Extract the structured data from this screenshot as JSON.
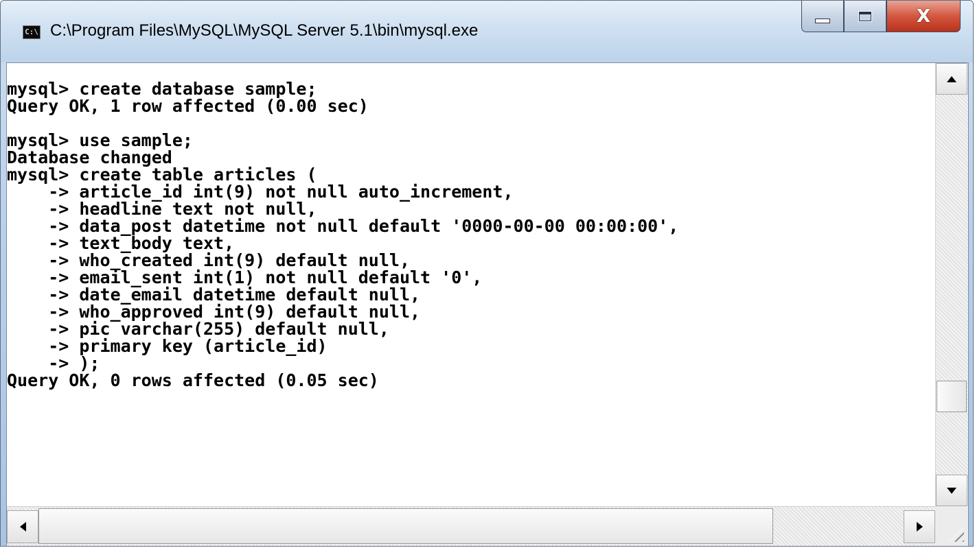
{
  "window": {
    "title": "C:\\Program Files\\MySQL\\MySQL Server 5.1\\bin\\mysql.exe",
    "icon": "cmd-console-icon",
    "icon_glyph": "C:\\",
    "buttons": {
      "minimize": "minimize-icon",
      "maximize": "maximize-icon",
      "close_glyph": "X"
    }
  },
  "console": {
    "lines": [
      "mysql> create database sample;",
      "Query OK, 1 row affected (0.00 sec)",
      "",
      "mysql> use sample;",
      "Database changed",
      "mysql> create table articles (",
      "    -> article_id int(9) not null auto_increment,",
      "    -> headline text not null,",
      "    -> data_post datetime not null default '0000-00-00 00:00:00',",
      "    -> text_body text,",
      "    -> who_created int(9) default null,",
      "    -> email_sent int(1) not null default '0',",
      "    -> date_email datetime default null,",
      "    -> who_approved int(9) default null,",
      "    -> pic varchar(255) default null,",
      "    -> primary key (article_id)",
      "    -> );",
      "Query OK, 0 rows affected (0.05 sec)"
    ]
  },
  "scrollbars": {
    "vertical_position": 0.82,
    "horizontal_position": 0.0
  }
}
